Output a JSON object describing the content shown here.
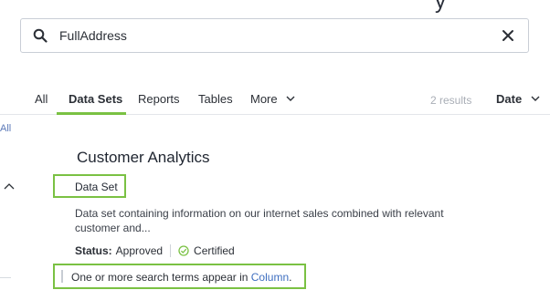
{
  "header": {
    "cropped_title_fragment": "y"
  },
  "search": {
    "value": "FullAddress"
  },
  "tabs": [
    {
      "label": "All",
      "active": false
    },
    {
      "label": "Data Sets",
      "active": true
    },
    {
      "label": "Reports",
      "active": false
    },
    {
      "label": "Tables",
      "active": false
    },
    {
      "label": "More",
      "active": false,
      "dropdown": true
    }
  ],
  "results": {
    "count_text": "2 results",
    "sort_label": "Date"
  },
  "rail": {
    "all_label": "All"
  },
  "result": {
    "title": "Customer Analytics",
    "type": "Data Set",
    "description": "Data set containing information on our internet sales combined with relevant customer and...",
    "status_key": "Status:",
    "status_value": "Approved",
    "certified_label": "Certified",
    "match_prefix": "One or more search terms appear in",
    "match_link": "Column",
    "match_suffix": "."
  },
  "colors": {
    "accent": "#7ac143",
    "link": "#3e6ec0",
    "muted": "#a9aeb6"
  },
  "icons": [
    "search-icon",
    "close-icon",
    "chevron-down-icon",
    "chevron-up-icon",
    "check-circle-icon"
  ]
}
